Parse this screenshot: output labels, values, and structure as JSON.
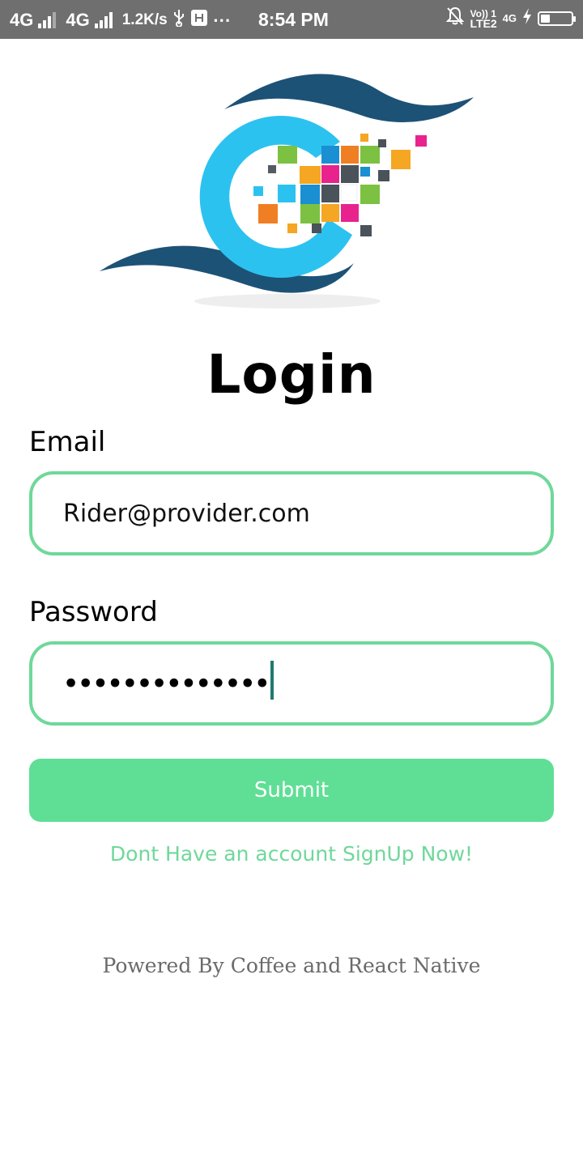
{
  "status_bar": {
    "network1": "4G",
    "network2": "4G",
    "speed": "1.2K/s",
    "time": "8:54 PM",
    "volte_top": "Vo)) 1",
    "volte_bottom": "LTE2",
    "network3": "4G",
    "battery_level": 0.3
  },
  "page": {
    "title": "Login",
    "email_label": "Email",
    "email_value": "Rider@provider.com",
    "password_label": "Password",
    "password_mask": "••••••••••••••",
    "submit_label": "Submit",
    "signup_link": "Dont Have an account SignUp Now!",
    "footer": "Powered By Coffee and React Native"
  },
  "colors": {
    "accent": "#5fdf95",
    "field_border": "#6fd89a",
    "status_bar": "#6f6f6f"
  }
}
